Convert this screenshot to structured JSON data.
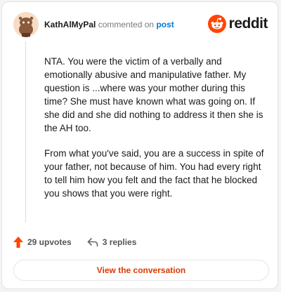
{
  "comment": {
    "username": "KathAlMyPal",
    "action_text": "commented on",
    "post_link": "post",
    "paragraphs": [
      "NTA. You were the victim of a verbally and emotionally abusive and manipulative father. My question is ...where was your mother during this time? She must have known what was going on. If she did and she did nothing to address it then she is the AH too.",
      "From what you've said, you are a success in spite of your father, not because of him. You had every right to tell him how you felt and the fact that he blocked you shows that you were right."
    ]
  },
  "brand": {
    "name": "reddit",
    "color": "#ff4500",
    "icon": "reddit-logo-icon"
  },
  "actions": {
    "upvotes": "29 upvotes",
    "replies": "3 replies",
    "upvote_icon": "upvote-arrow-icon",
    "reply_icon": "reply-arrow-icon"
  },
  "cta": {
    "label": "View the conversation",
    "color": "#d93a00"
  }
}
